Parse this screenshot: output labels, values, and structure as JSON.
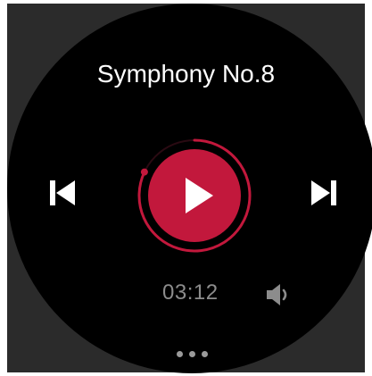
{
  "player": {
    "title": "Symphony No.8",
    "elapsed_time": "03:12",
    "progress": 0.82
  },
  "controls": {
    "previous_icon": "skip-previous-icon",
    "next_icon": "skip-next-icon",
    "play_icon": "play-icon",
    "volume_icon": "volume-icon"
  },
  "pager": {
    "dot_count": 3
  },
  "colors": {
    "accent": "#c2183c",
    "background": "#000000",
    "bezel": "#2b2b2b",
    "title_text": "#ffffff",
    "secondary_text": "#8c8c8c",
    "dot": "#9a9a9a"
  }
}
